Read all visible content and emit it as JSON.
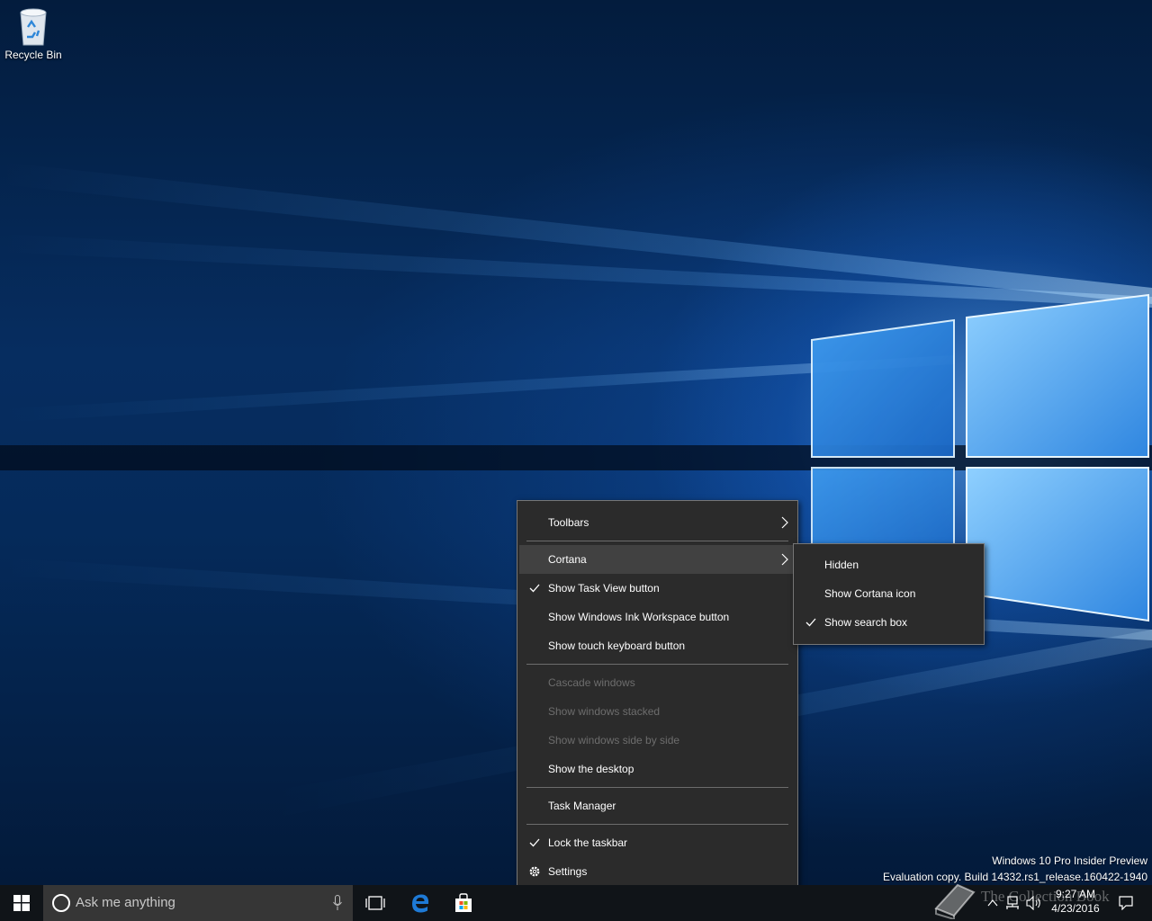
{
  "desktop": {
    "icons": [
      {
        "label": "Recycle Bin",
        "icon": "recycle-bin-icon"
      }
    ],
    "watermark": {
      "line1": "Windows 10 Pro Insider Preview",
      "line2": "Evaluation copy. Build 14332.rs1_release.160422-1940"
    },
    "brand_overlay": "The Collection Book"
  },
  "context_menu": {
    "items": [
      {
        "label": "Toolbars",
        "submenu": true,
        "checked": false,
        "disabled": false
      },
      {
        "label": "Cortana",
        "submenu": true,
        "checked": false,
        "disabled": false,
        "highlighted": true
      },
      {
        "label": "Show Task View button",
        "checked": true
      },
      {
        "label": "Show Windows Ink Workspace button",
        "checked": false
      },
      {
        "label": "Show touch keyboard button",
        "checked": false
      },
      {
        "label": "Cascade windows",
        "disabled": true
      },
      {
        "label": "Show windows stacked",
        "disabled": true
      },
      {
        "label": "Show windows side by side",
        "disabled": true
      },
      {
        "label": "Show the desktop",
        "disabled": false
      },
      {
        "label": "Task Manager",
        "disabled": false
      },
      {
        "label": "Lock the taskbar",
        "checked": true
      },
      {
        "label": "Settings",
        "icon": "gear-icon"
      }
    ]
  },
  "cortana_submenu": {
    "items": [
      {
        "label": "Hidden",
        "checked": false
      },
      {
        "label": "Show Cortana icon",
        "checked": false
      },
      {
        "label": "Show search box",
        "checked": true
      }
    ]
  },
  "taskbar": {
    "search_placeholder": "Ask me anything",
    "pinned": [
      "task-view-icon",
      "edge-icon",
      "store-icon"
    ],
    "clock": {
      "time": "9:27 AM",
      "date": "4/23/2016"
    }
  },
  "colors": {
    "menu_bg": "#2b2b2b",
    "menu_border": "#767676",
    "menu_highlight": "#414141",
    "taskbar_bg": "#101418",
    "search_bg": "#363636",
    "edge_blue": "#1e7ad6"
  }
}
